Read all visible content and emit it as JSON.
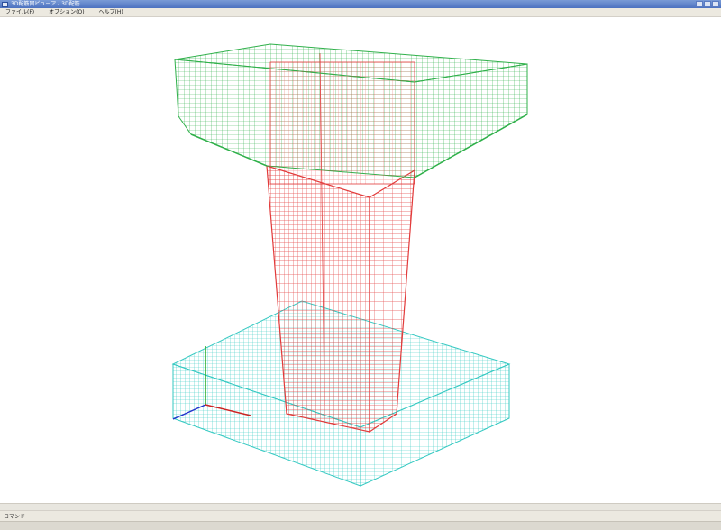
{
  "window": {
    "title": "3D配筋図ビューア - 3D配筋",
    "controls": [
      "minimize",
      "maximize",
      "close"
    ]
  },
  "menu": {
    "items": [
      {
        "label": "ファイル(F)"
      },
      {
        "label": "オプション(O)"
      },
      {
        "label": "ヘルプ(H)"
      }
    ]
  },
  "viewport": {
    "model": "3D rebar wireframe (pier cap, column, footing)",
    "colors": {
      "cap": "#2fb04a",
      "column": "#e23a3a",
      "footing": "#35c9c2",
      "axis_x": "#cc2222",
      "axis_y": "#22aa22",
      "axis_z": "#2233cc"
    }
  },
  "status": {
    "text": "コマンド"
  }
}
